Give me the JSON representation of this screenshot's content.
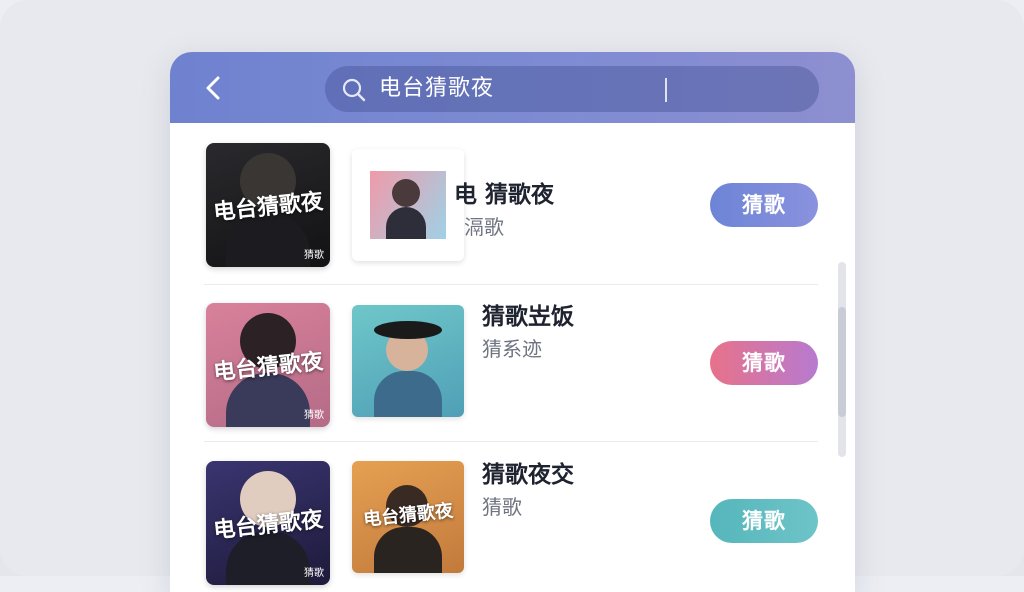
{
  "header": {
    "search_query": "电台猜歌夜",
    "colors": {
      "start": "#6f82cf",
      "end": "#8d8fd0"
    }
  },
  "icons": {
    "back": "chevron-left-icon",
    "search": "search-icon"
  },
  "rows": [
    {
      "poster_text": "电台猜歌夜",
      "poster_tag": "猜歌",
      "title": "电 猜歌夜",
      "subtitle": "滆歌",
      "button_label": "猜歌",
      "button_color": "#7388d6"
    },
    {
      "poster_text": "电台猜歌夜",
      "poster_tag": "猜歌",
      "title": "猜歌岦饭",
      "subtitle": "猜系迹",
      "button_label": "猜歌",
      "button_color": "#e8707f"
    },
    {
      "poster_text": "电台猜歌夜",
      "poster_tag": "猜歌",
      "thumb_text": "电台猜歌夜",
      "title": "猜歌夜交",
      "subtitle": "猜歌",
      "button_label": "猜歌",
      "button_color": "#5bb7bd"
    }
  ]
}
